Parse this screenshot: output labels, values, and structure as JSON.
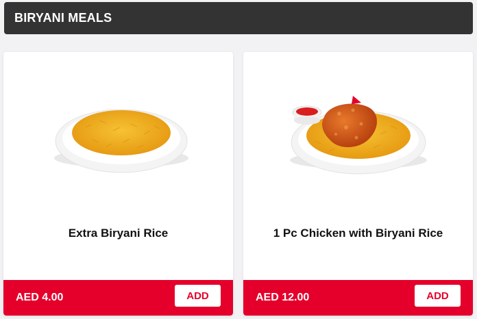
{
  "section": {
    "title": "BIRYANI MEALS"
  },
  "products": [
    {
      "name": "Extra Biryani Rice",
      "price": "AED 4.00",
      "add_label": "ADD",
      "image_icon": "biryani-rice-plate-image"
    },
    {
      "name": "1 Pc Chicken with Biryani Rice",
      "price": "AED 12.00",
      "add_label": "ADD",
      "image_icon": "chicken-biryani-plate-image"
    }
  ],
  "colors": {
    "header_bg": "#333333",
    "accent_red": "#e4002b",
    "rice": "#f2b01e",
    "chicken": "#d2561c"
  }
}
